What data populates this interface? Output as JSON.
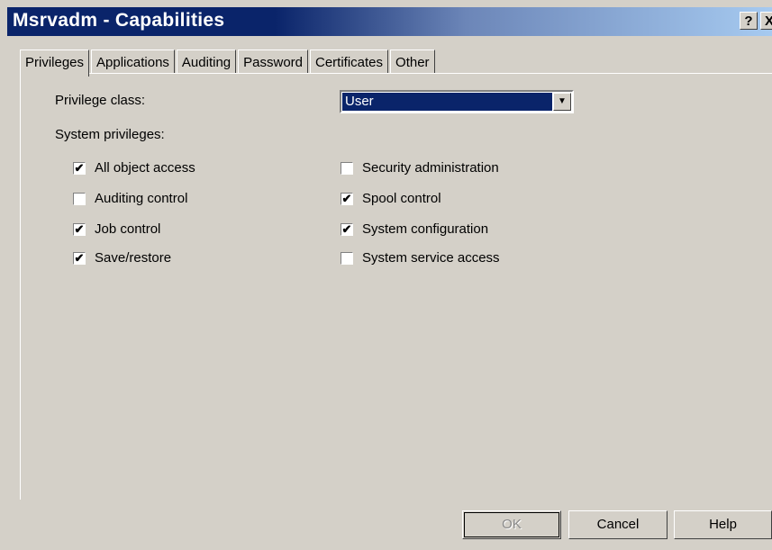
{
  "window": {
    "title": "Msrvadm - Capabilities",
    "help_label": "?",
    "close_label": "X"
  },
  "tabs": [
    {
      "label": "Privileges"
    },
    {
      "label": "Applications"
    },
    {
      "label": "Auditing"
    },
    {
      "label": "Password"
    },
    {
      "label": "Certificates"
    },
    {
      "label": "Other"
    }
  ],
  "privileges": {
    "class_label": "Privilege class:",
    "class_value": "User",
    "system_label": "System privileges:",
    "items": [
      {
        "label": "All object access",
        "checked": true,
        "mark": "✔"
      },
      {
        "label": "Auditing control",
        "checked": false,
        "mark": ""
      },
      {
        "label": "Job control",
        "checked": true,
        "mark": "✔"
      },
      {
        "label": "Save/restore",
        "checked": true,
        "mark": "✔"
      },
      {
        "label": "Security administration",
        "checked": false,
        "mark": ""
      },
      {
        "label": "Spool control",
        "checked": true,
        "mark": "✔"
      },
      {
        "label": "System configuration",
        "checked": true,
        "mark": "✔"
      },
      {
        "label": "System service access",
        "checked": false,
        "mark": ""
      }
    ]
  },
  "buttons": {
    "ok": "OK",
    "cancel": "Cancel",
    "help": "Help"
  }
}
